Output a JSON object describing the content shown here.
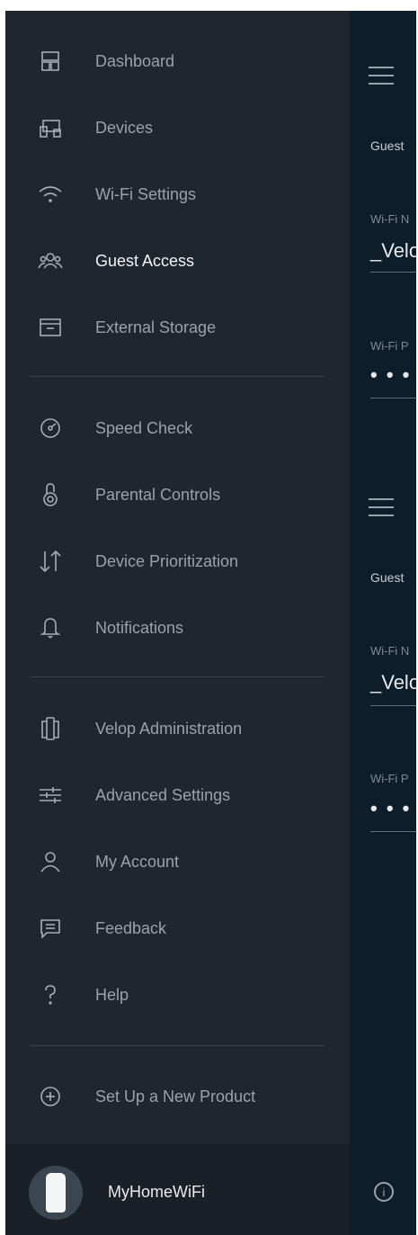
{
  "drawer": {
    "group1": [
      {
        "label": "Dashboard",
        "icon": "dashboard-icon"
      },
      {
        "label": "Devices",
        "icon": "devices-icon"
      },
      {
        "label": "Wi-Fi Settings",
        "icon": "wifi-icon"
      },
      {
        "label": "Guest Access",
        "icon": "guest-access-icon",
        "active": true
      },
      {
        "label": "External Storage",
        "icon": "storage-icon"
      }
    ],
    "group2": [
      {
        "label": "Speed Check",
        "icon": "speedometer-icon"
      },
      {
        "label": "Parental Controls",
        "icon": "lock-icon"
      },
      {
        "label": "Device Prioritization",
        "icon": "priority-arrows-icon"
      },
      {
        "label": "Notifications",
        "icon": "bell-icon"
      }
    ],
    "group3": [
      {
        "label": "Velop Administration",
        "icon": "velop-nodes-icon"
      },
      {
        "label": "Advanced Settings",
        "icon": "sliders-icon"
      },
      {
        "label": "My Account",
        "icon": "account-icon"
      },
      {
        "label": "Feedback",
        "icon": "chat-icon"
      },
      {
        "label": "Help",
        "icon": "help-icon"
      }
    ],
    "group4": [
      {
        "label": "Set Up a New Product",
        "icon": "add-circle-icon"
      }
    ],
    "footer": {
      "network_name": "MyHomeWiFi"
    }
  },
  "background": {
    "section1": {
      "title": "Guest",
      "wifi_name_label": "Wi-Fi N",
      "wifi_name": "_Velo",
      "wifi_pass_label": "Wi-Fi P",
      "wifi_pass": "• • •"
    },
    "section2": {
      "title": "Guest",
      "wifi_name_label": "Wi-Fi N",
      "wifi_name": "_Velo",
      "wifi_pass_label": "Wi-Fi P",
      "wifi_pass": "• • •"
    },
    "info_icon": "i"
  },
  "colors": {
    "drawer_bg": "#20262d",
    "panel_bg": "#0e1d2a",
    "active_text": "#f2f4f6",
    "inactive_text": "#9aa2aa"
  }
}
